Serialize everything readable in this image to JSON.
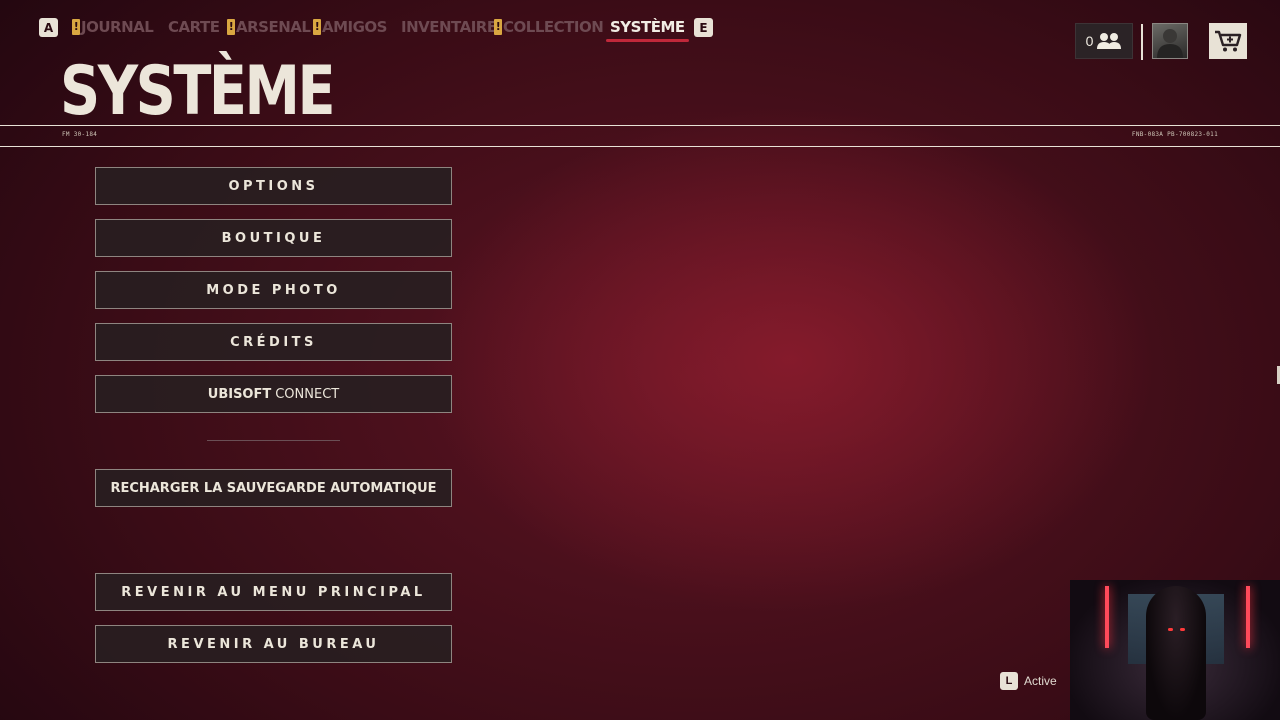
{
  "nav": {
    "prev_key": "A",
    "next_key": "E",
    "alert_glyph": "!",
    "tabs": [
      {
        "label": "JOURNAL",
        "alert": true
      },
      {
        "label": "CARTE",
        "alert": false
      },
      {
        "label": "ARSENAL",
        "alert": true
      },
      {
        "label": "AMIGOS",
        "alert": true
      },
      {
        "label": "INVENTAIRE",
        "alert": false
      },
      {
        "label": "COLLECTION",
        "alert": true
      },
      {
        "label": "SYSTÈME",
        "alert": false,
        "active": true
      }
    ]
  },
  "header": {
    "friends_count": "0",
    "friends_icon": "people-icon",
    "cart_icon": "cart-icon"
  },
  "page": {
    "title": "SYSTÈME",
    "code_left": "FM 30-184",
    "code_right": "FNB-083A PB-700823-011"
  },
  "menu": {
    "options": "OPTIONS",
    "boutique": "BOUTIQUE",
    "mode_photo": "MODE PHOTO",
    "credits": "CRÉDITS",
    "ubisoft_brand": "UBISOFT",
    "ubisoft_connect": "CONNECT",
    "reload_save": "RECHARGER LA SAUVEGARDE AUTOMATIQUE",
    "main_menu": "REVENIR AU MENU PRINCIPAL",
    "desktop": "REVENIR AU BUREAU"
  },
  "overlay": {
    "activate_key": "L",
    "activate_text": "Active"
  },
  "colors": {
    "accent_red": "#c0283a",
    "alert_yellow": "#d9a741",
    "text_cream": "#ece6da"
  }
}
